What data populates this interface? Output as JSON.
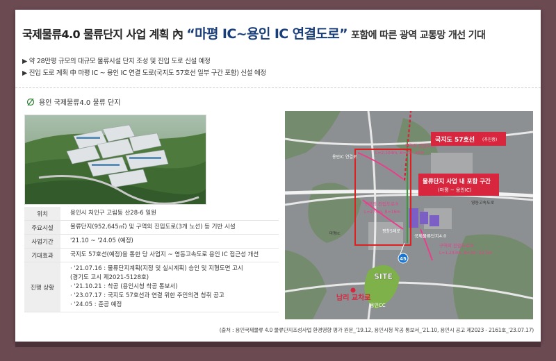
{
  "title": {
    "prefix": "국제물류4.0 물류단지 사업 계획 內",
    "highlight": "“마평 IC~용인 IC 연결도로”",
    "suffix": "포함에 따른 광역 교통망 개선 기대"
  },
  "bullets": [
    "▶ 약 28만평 규모의 대규모 물류시설 단지 조성 및 진입 도로 신설 예정",
    "▶ 진입 도로 계획 中 마평 IC ~ 용인 IC 연결 도로(국지도 57호선 일부 구간 포함) 신설 예정"
  ],
  "section": {
    "label": "용인 국제물류4.0 물류 단지"
  },
  "info_rows": [
    {
      "key": "위치",
      "lines": [
        "용인시 처인구 고림동 산28-6 일원"
      ]
    },
    {
      "key": "주요시설",
      "lines": [
        "물류단지(952,645㎡) 및 구역외 진입도로(3개 노선) 등 기반 시설"
      ]
    },
    {
      "key": "사업기간",
      "lines": [
        "'21.10 ~ '24.05 (예정)"
      ]
    },
    {
      "key": "기대효과",
      "lines": [
        "국지도 57호선(예정)을 통한 당 사업지 ~ 영동고속도로 용인 IC 접근성 개선"
      ]
    },
    {
      "key": "진행 상황",
      "lines": [
        "· '21.07.16 : 물류단지계획(지정 및 실시계획) 승인 및 지형도면 고시",
        "  (경기도 고시 제2021-5128호)",
        "· '21.10.21 : 착공 (용인시청 착공 통보서)",
        "· '23.07.17 : 국지도 57호선과 연결 위한 주민의견 청취 공고",
        "· '24.05 : 준공 예정"
      ]
    }
  ],
  "map": {
    "route1": "구역외 진입도로①",
    "route1_spec": "L=2,104m, B=12~26m",
    "ic_yongin": "용인IC 연결로",
    "route3": "구역외 진입도로③",
    "route3_spec": "L=274m, B=16m",
    "pyeongchang": "평창5례로",
    "site_name": "국제물류단지4.0",
    "route2": "구역외 진입도로②",
    "route2_spec": "L=1,243m, B=20~22.5m",
    "road57": "국지도 57호선",
    "road57_tag": "(추진중)",
    "section_title": "물류단지 사업 내 포함 구간",
    "section_sub": "(마평 ~ 용인IC)",
    "highway": "영동고속도로",
    "route45": "45",
    "site": "SITE",
    "nam_ri": "남리 교차로",
    "golf": "용인CC",
    "mapyeong": "마평IC",
    "yongin_terminal": "용인종합\n버스터미널",
    "seoul": "서울용인 고속국도\n양지IC"
  },
  "source": "(출처 : 용인국제물류 4.0 물류단지조성사업 환경영향 평가 원문_'19.12, 용인시청 착공 통보서_'21.10, 용인시 공고 제2023 - 2161호_'23.07.17)",
  "colors": {
    "accent_blue": "#1a3e7a",
    "route_pink": "#e83e8c",
    "route_red": "#d7263d",
    "box_red": "#e02020",
    "green": "#3a9a3a"
  }
}
